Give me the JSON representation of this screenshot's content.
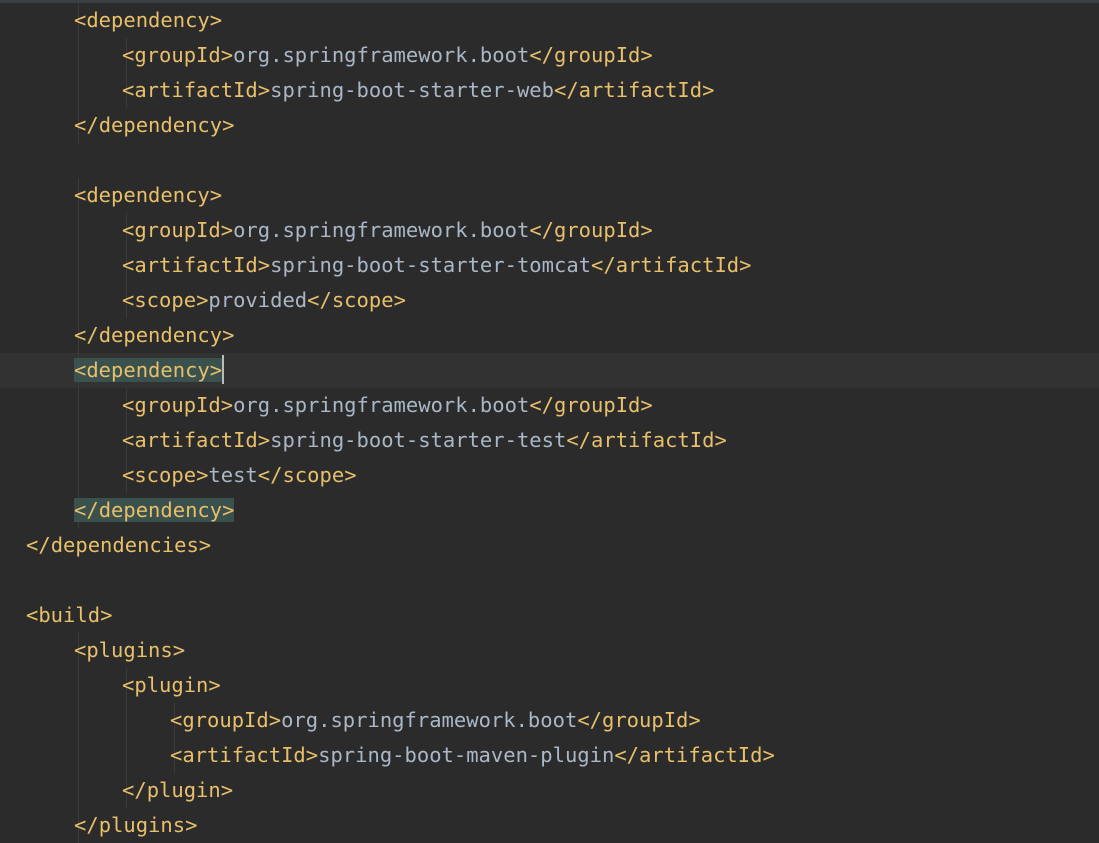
{
  "editor": {
    "language": "xml",
    "colors": {
      "background": "#2b2b2b",
      "tag": "#e8bf6a",
      "text": "#a9b7c6",
      "caret_line": "#323232",
      "brace_match": "#3b514d"
    },
    "lines": [
      {
        "indent": 2,
        "open": "dependency",
        "text": "",
        "close": ""
      },
      {
        "indent": 3,
        "open": "groupId",
        "text": "org.springframework.boot",
        "close": "groupId"
      },
      {
        "indent": 3,
        "open": "artifactId",
        "text": "spring-boot-starter-web",
        "close": "artifactId"
      },
      {
        "indent": 2,
        "open": "",
        "text": "",
        "close": "dependency"
      },
      {
        "indent": 0,
        "open": "",
        "text": "",
        "close": ""
      },
      {
        "indent": 2,
        "open": "dependency",
        "text": "",
        "close": ""
      },
      {
        "indent": 3,
        "open": "groupId",
        "text": "org.springframework.boot",
        "close": "groupId"
      },
      {
        "indent": 3,
        "open": "artifactId",
        "text": "spring-boot-starter-tomcat",
        "close": "artifactId"
      },
      {
        "indent": 3,
        "open": "scope",
        "text": "provided",
        "close": "scope"
      },
      {
        "indent": 2,
        "open": "",
        "text": "",
        "close": "dependency"
      },
      {
        "indent": 2,
        "open": "dependency",
        "text": "",
        "close": "",
        "caret": true,
        "match": true
      },
      {
        "indent": 3,
        "open": "groupId",
        "text": "org.springframework.boot",
        "close": "groupId"
      },
      {
        "indent": 3,
        "open": "artifactId",
        "text": "spring-boot-starter-test",
        "close": "artifactId"
      },
      {
        "indent": 3,
        "open": "scope",
        "text": "test",
        "close": "scope"
      },
      {
        "indent": 2,
        "open": "",
        "text": "",
        "close": "dependency",
        "match": true
      },
      {
        "indent": 1,
        "open": "",
        "text": "",
        "close": "dependencies"
      },
      {
        "indent": 0,
        "open": "",
        "text": "",
        "close": ""
      },
      {
        "indent": 1,
        "open": "build",
        "text": "",
        "close": ""
      },
      {
        "indent": 2,
        "open": "plugins",
        "text": "",
        "close": ""
      },
      {
        "indent": 3,
        "open": "plugin",
        "text": "",
        "close": ""
      },
      {
        "indent": 4,
        "open": "groupId",
        "text": "org.springframework.boot",
        "close": "groupId"
      },
      {
        "indent": 4,
        "open": "artifactId",
        "text": "spring-boot-maven-plugin",
        "close": "artifactId"
      },
      {
        "indent": 3,
        "open": "",
        "text": "",
        "close": "plugin"
      },
      {
        "indent": 2,
        "open": "",
        "text": "",
        "close": "plugins"
      }
    ]
  }
}
